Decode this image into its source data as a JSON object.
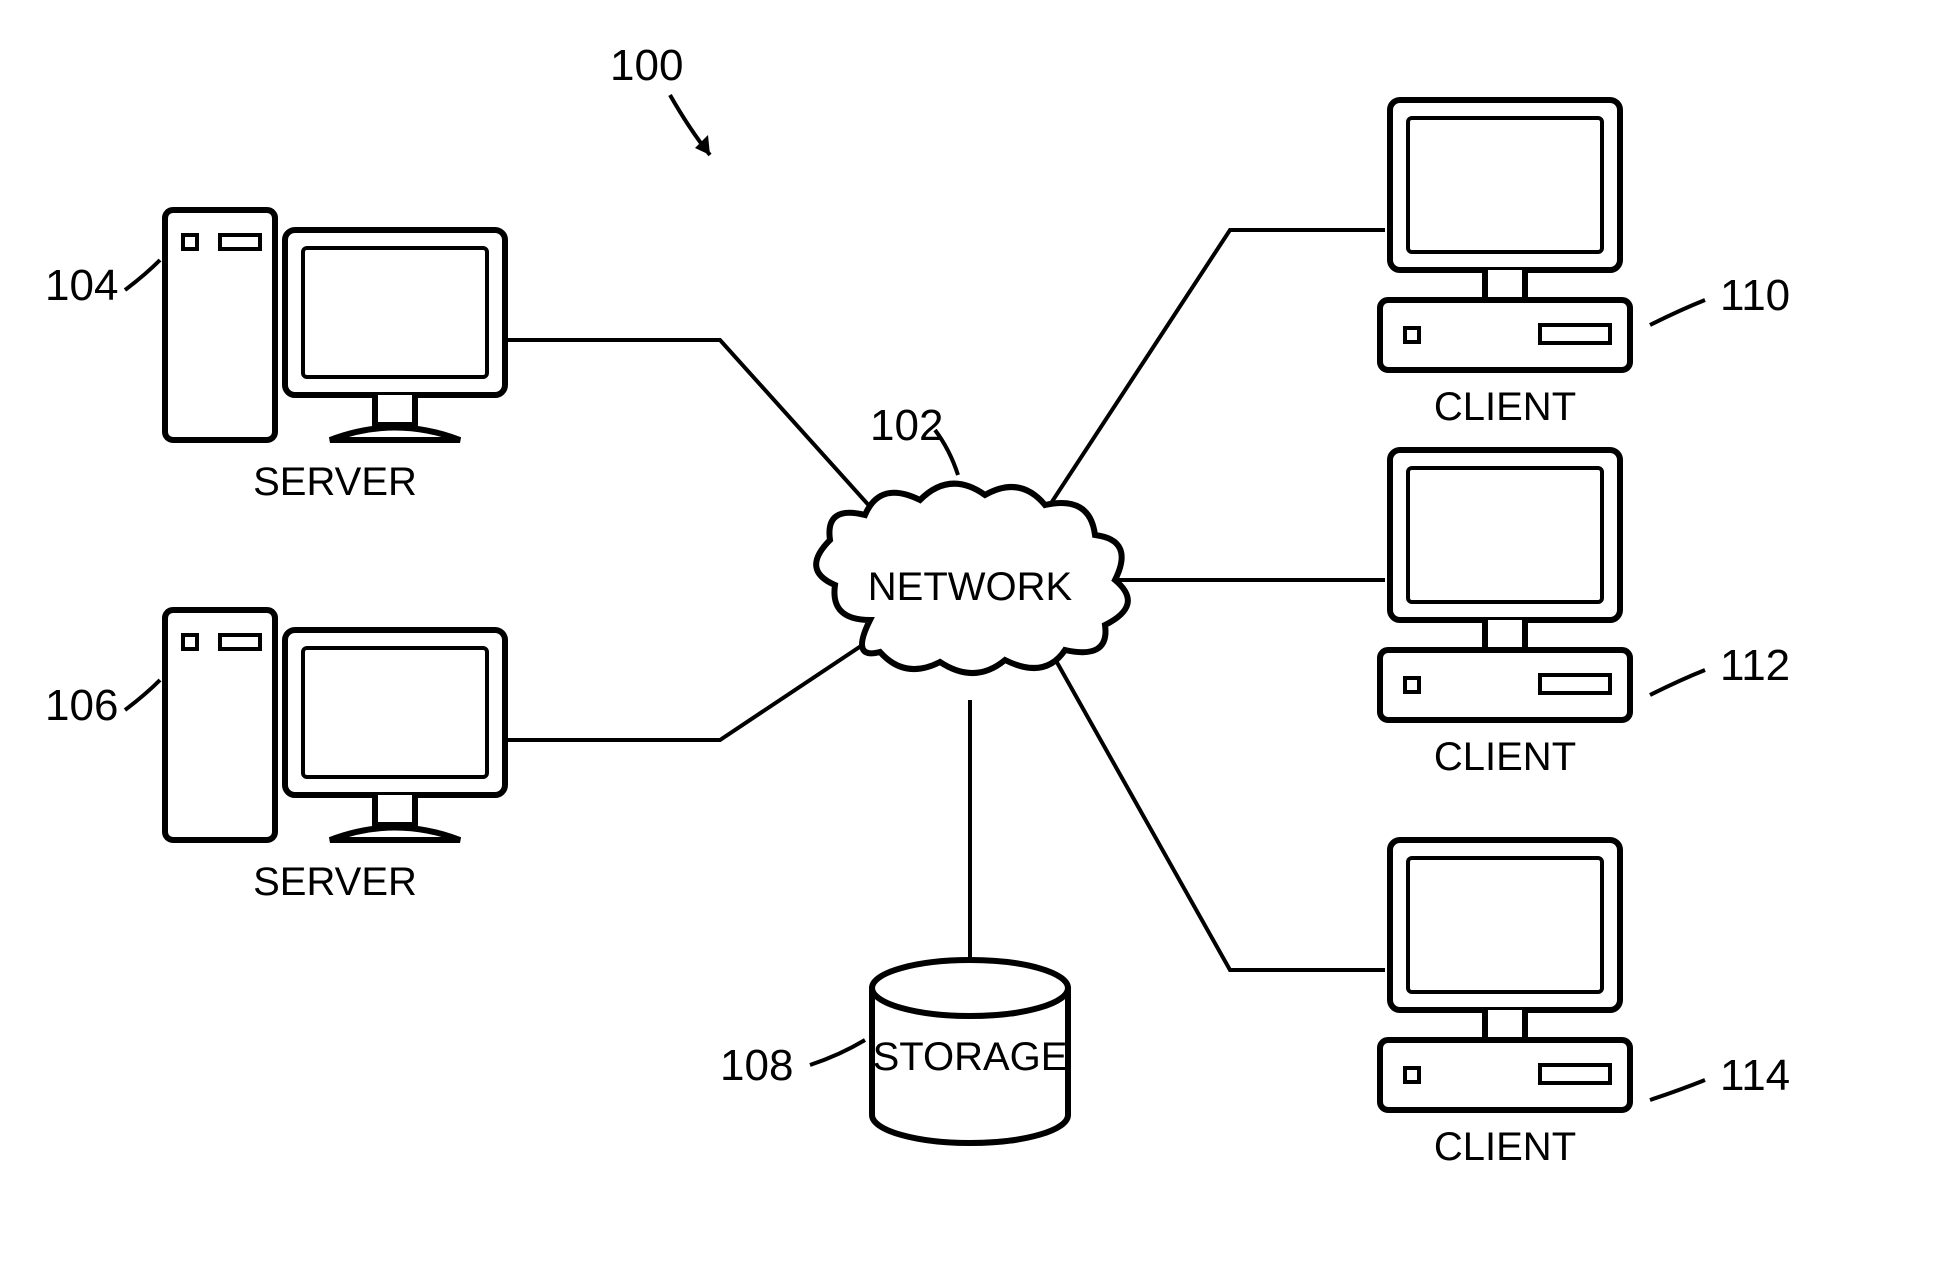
{
  "figure_ref": "100",
  "network": {
    "ref": "102",
    "label": "NETWORK"
  },
  "storage": {
    "ref": "108",
    "label": "STORAGE"
  },
  "servers": [
    {
      "ref": "104",
      "label": "SERVER"
    },
    {
      "ref": "106",
      "label": "SERVER"
    }
  ],
  "clients": [
    {
      "ref": "110",
      "label": "CLIENT"
    },
    {
      "ref": "112",
      "label": "CLIENT"
    },
    {
      "ref": "114",
      "label": "CLIENT"
    }
  ]
}
